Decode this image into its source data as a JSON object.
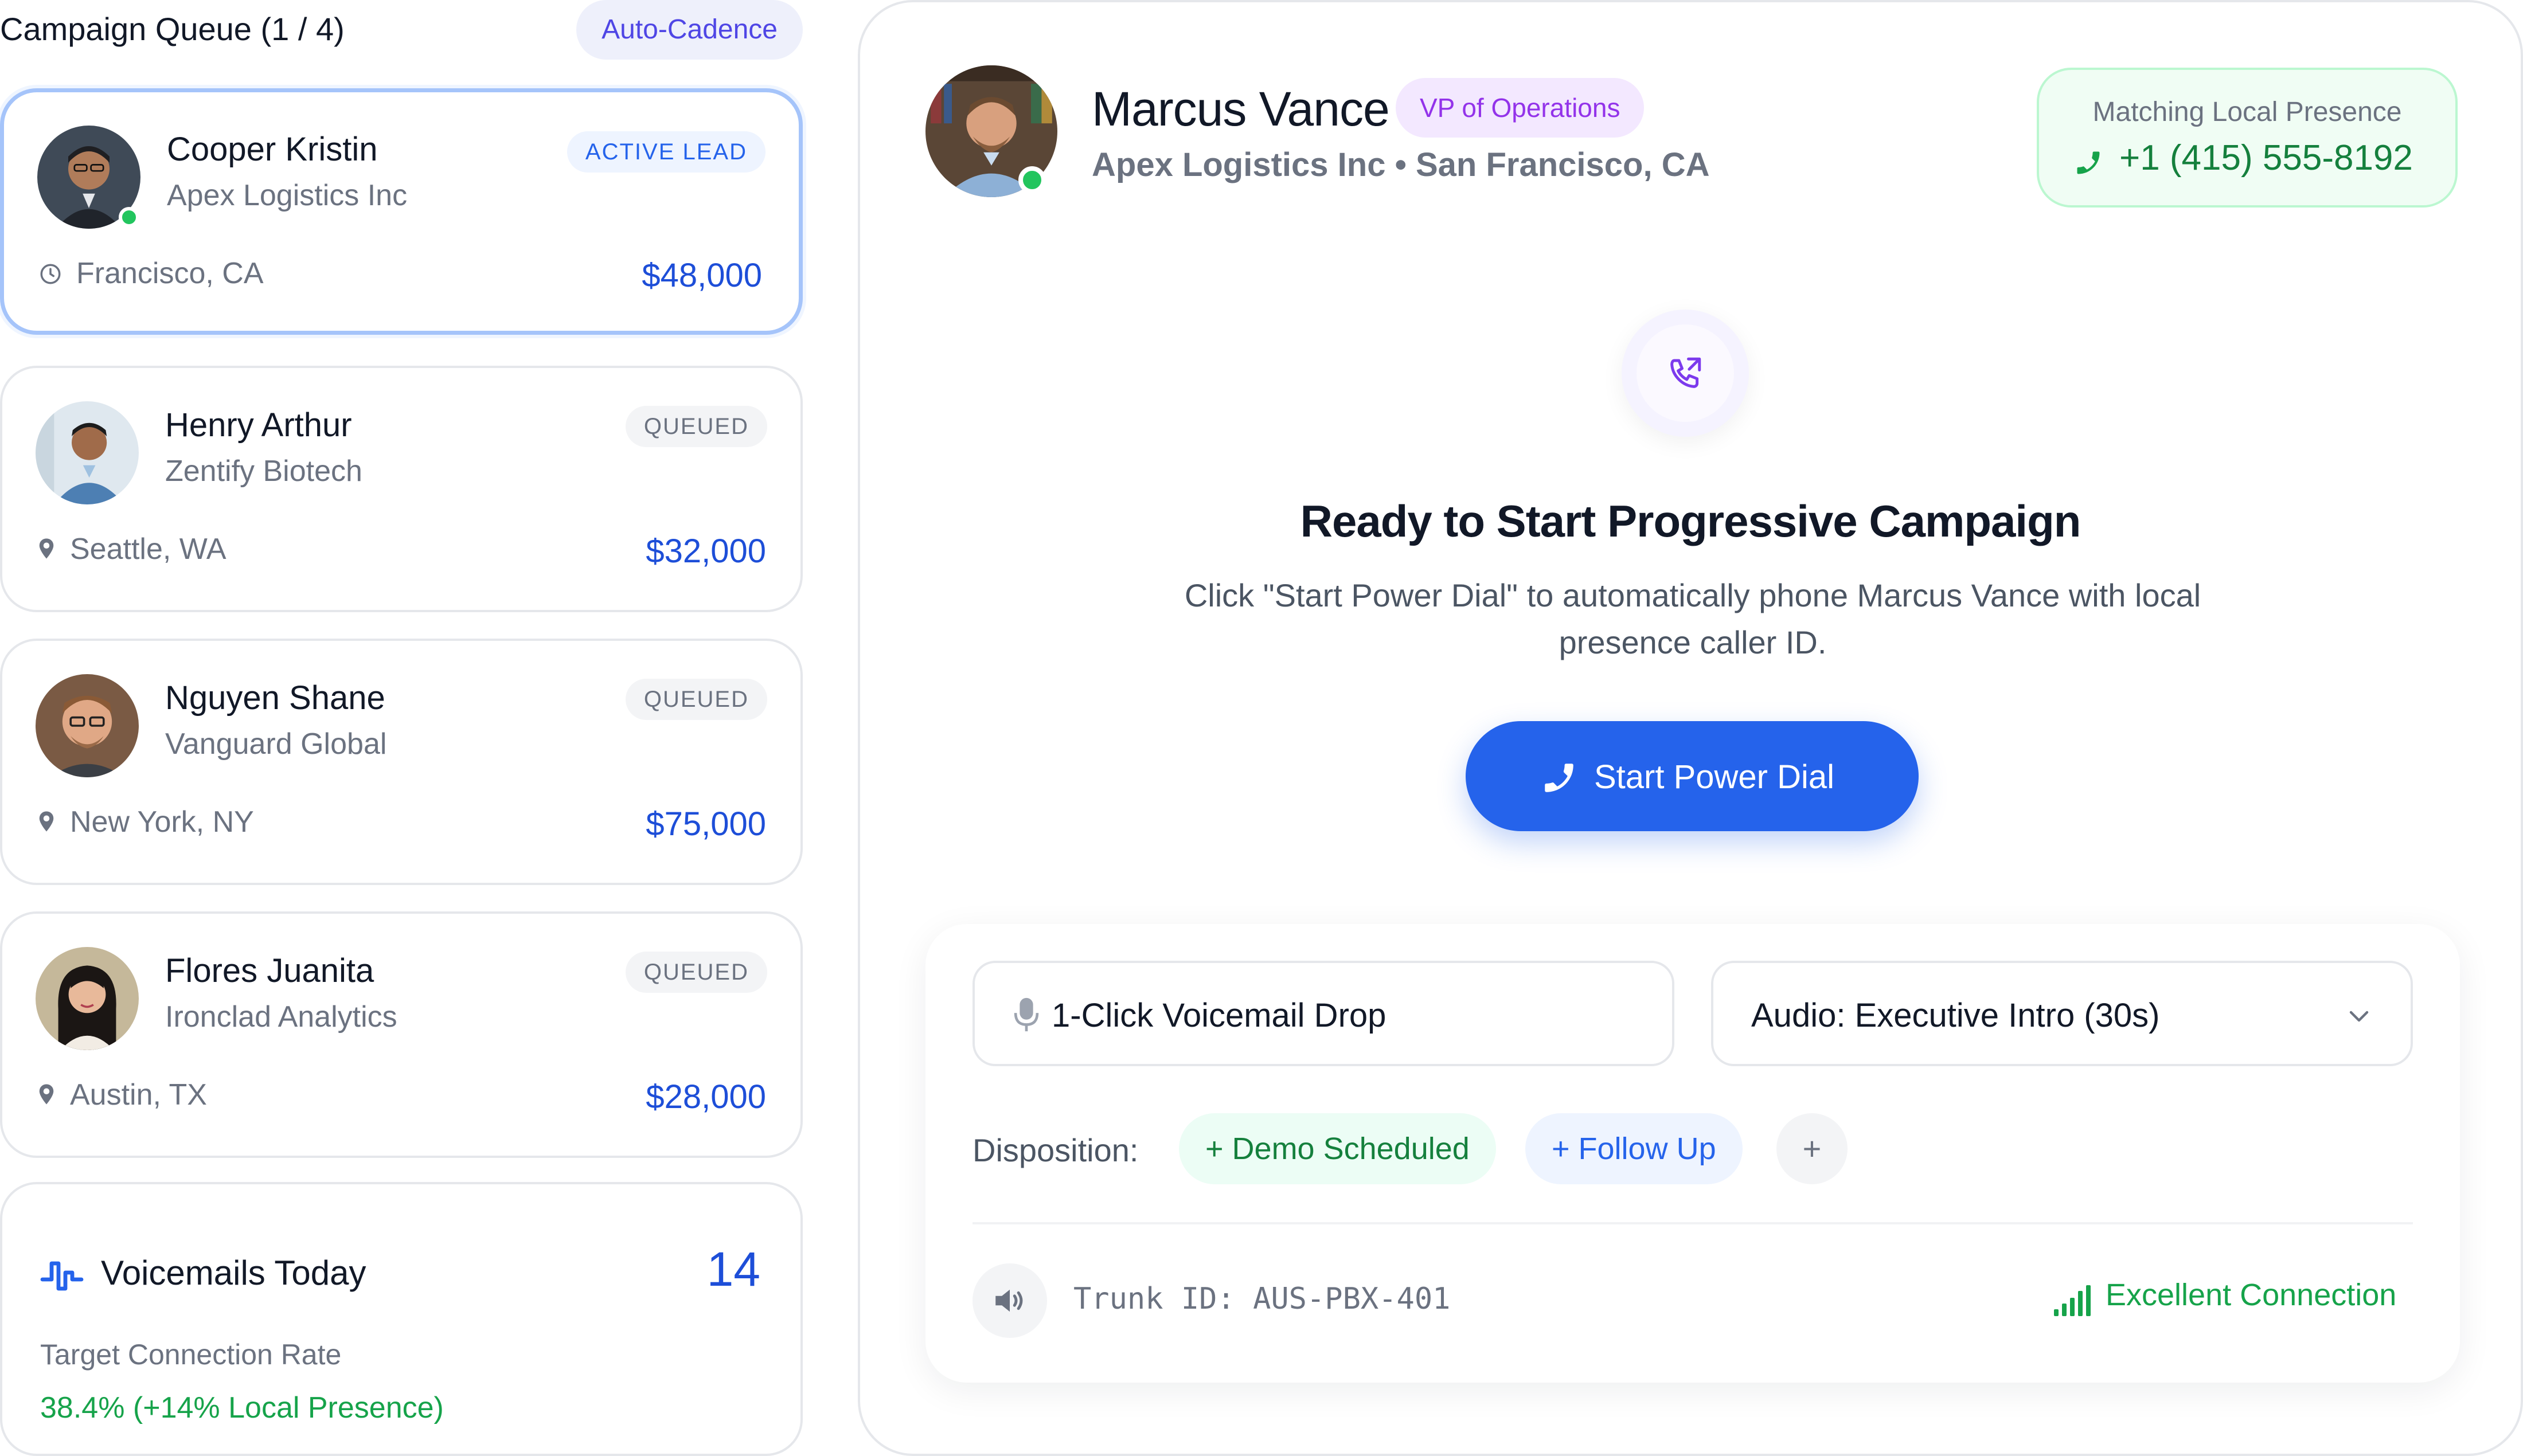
{
  "queue": {
    "title": "Campaign Queue (1 / 4)",
    "mode_label": "Auto-Cadence",
    "leads": [
      {
        "name": "Cooper Kristin",
        "company": "Apex Logistics Inc",
        "status": "ACTIVE LEAD",
        "location": "Francisco, CA",
        "location_icon": "clock-icon",
        "value": "$48,000",
        "online": true
      },
      {
        "name": "Henry Arthur",
        "company": "Zentify Biotech",
        "status": "QUEUED",
        "location": "Seattle, WA",
        "location_icon": "pin-icon",
        "value": "$32,000",
        "online": false
      },
      {
        "name": "Nguyen Shane",
        "company": "Vanguard Global",
        "status": "QUEUED",
        "location": "New York, NY",
        "location_icon": "pin-icon",
        "value": "$75,000",
        "online": false
      },
      {
        "name": "Flores Juanita",
        "company": "Ironclad Analytics",
        "status": "QUEUED",
        "location": "Austin, TX",
        "location_icon": "pin-icon",
        "value": "$28,000",
        "online": false
      }
    ]
  },
  "stats": {
    "title": "Voicemails Today",
    "count": "14",
    "subtitle": "Target Connection Rate",
    "rate": "38.4% (+14% Local Presence)",
    "icon": "pulse-icon"
  },
  "contact": {
    "name": "Marcus Vance",
    "role": "VP of Operations",
    "subtitle": "Apex Logistics Inc • San Francisco, CA",
    "online": true
  },
  "presence": {
    "label": "Matching Local Presence",
    "phone": "+1 (415) 555-8192"
  },
  "campaign": {
    "icon": "outgoing-call-icon",
    "title": "Ready to Start Progressive Campaign",
    "description": "Click \"Start Power Dial\" to automatically phone Marcus Vance with local presence caller ID.",
    "button_label": "Start Power Dial"
  },
  "controls": {
    "voicemail_label": "1-Click Voicemail Drop",
    "audio_selected": "Audio: Executive Intro (30s)",
    "disposition_label": "Disposition:",
    "dispositions": [
      "+ Demo Scheduled",
      "+ Follow Up"
    ],
    "add_label": "+",
    "trunk_id": "Trunk ID: AUS-PBX-401",
    "connection": "Excellent Connection"
  },
  "colors": {
    "accent": "#2563eb",
    "success": "#16a34a",
    "role": "#9333ea",
    "active_border": "#a5c4fa"
  }
}
